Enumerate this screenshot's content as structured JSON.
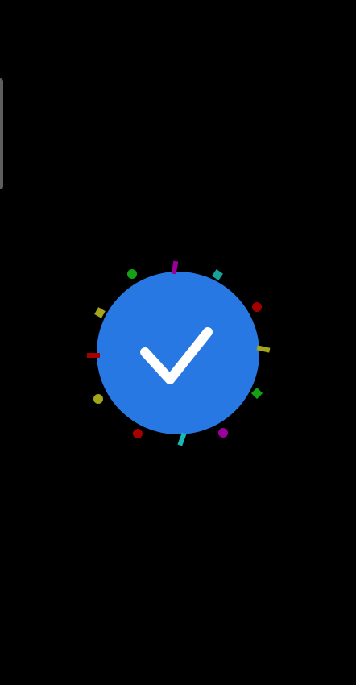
{
  "status": {
    "state": "success",
    "icon": "checkmark-icon",
    "circle_color": "#2878e4",
    "check_color": "#ffffff"
  },
  "confetti": [
    {
      "shape": "bar",
      "color": "#9b009b"
    },
    {
      "shape": "square",
      "color": "#18a39a"
    },
    {
      "shape": "dot",
      "color": "#a40000"
    },
    {
      "shape": "bar",
      "color": "#a5a51c"
    },
    {
      "shape": "square",
      "color": "#14a314"
    },
    {
      "shape": "dot",
      "color": "#9b009b"
    },
    {
      "shape": "bar",
      "color": "#18b8b8"
    },
    {
      "shape": "dot",
      "color": "#a40000"
    },
    {
      "shape": "dot",
      "color": "#a5a51c"
    },
    {
      "shape": "bar",
      "color": "#a40000"
    },
    {
      "shape": "square",
      "color": "#a5a51c"
    },
    {
      "shape": "dot",
      "color": "#14a314"
    }
  ]
}
